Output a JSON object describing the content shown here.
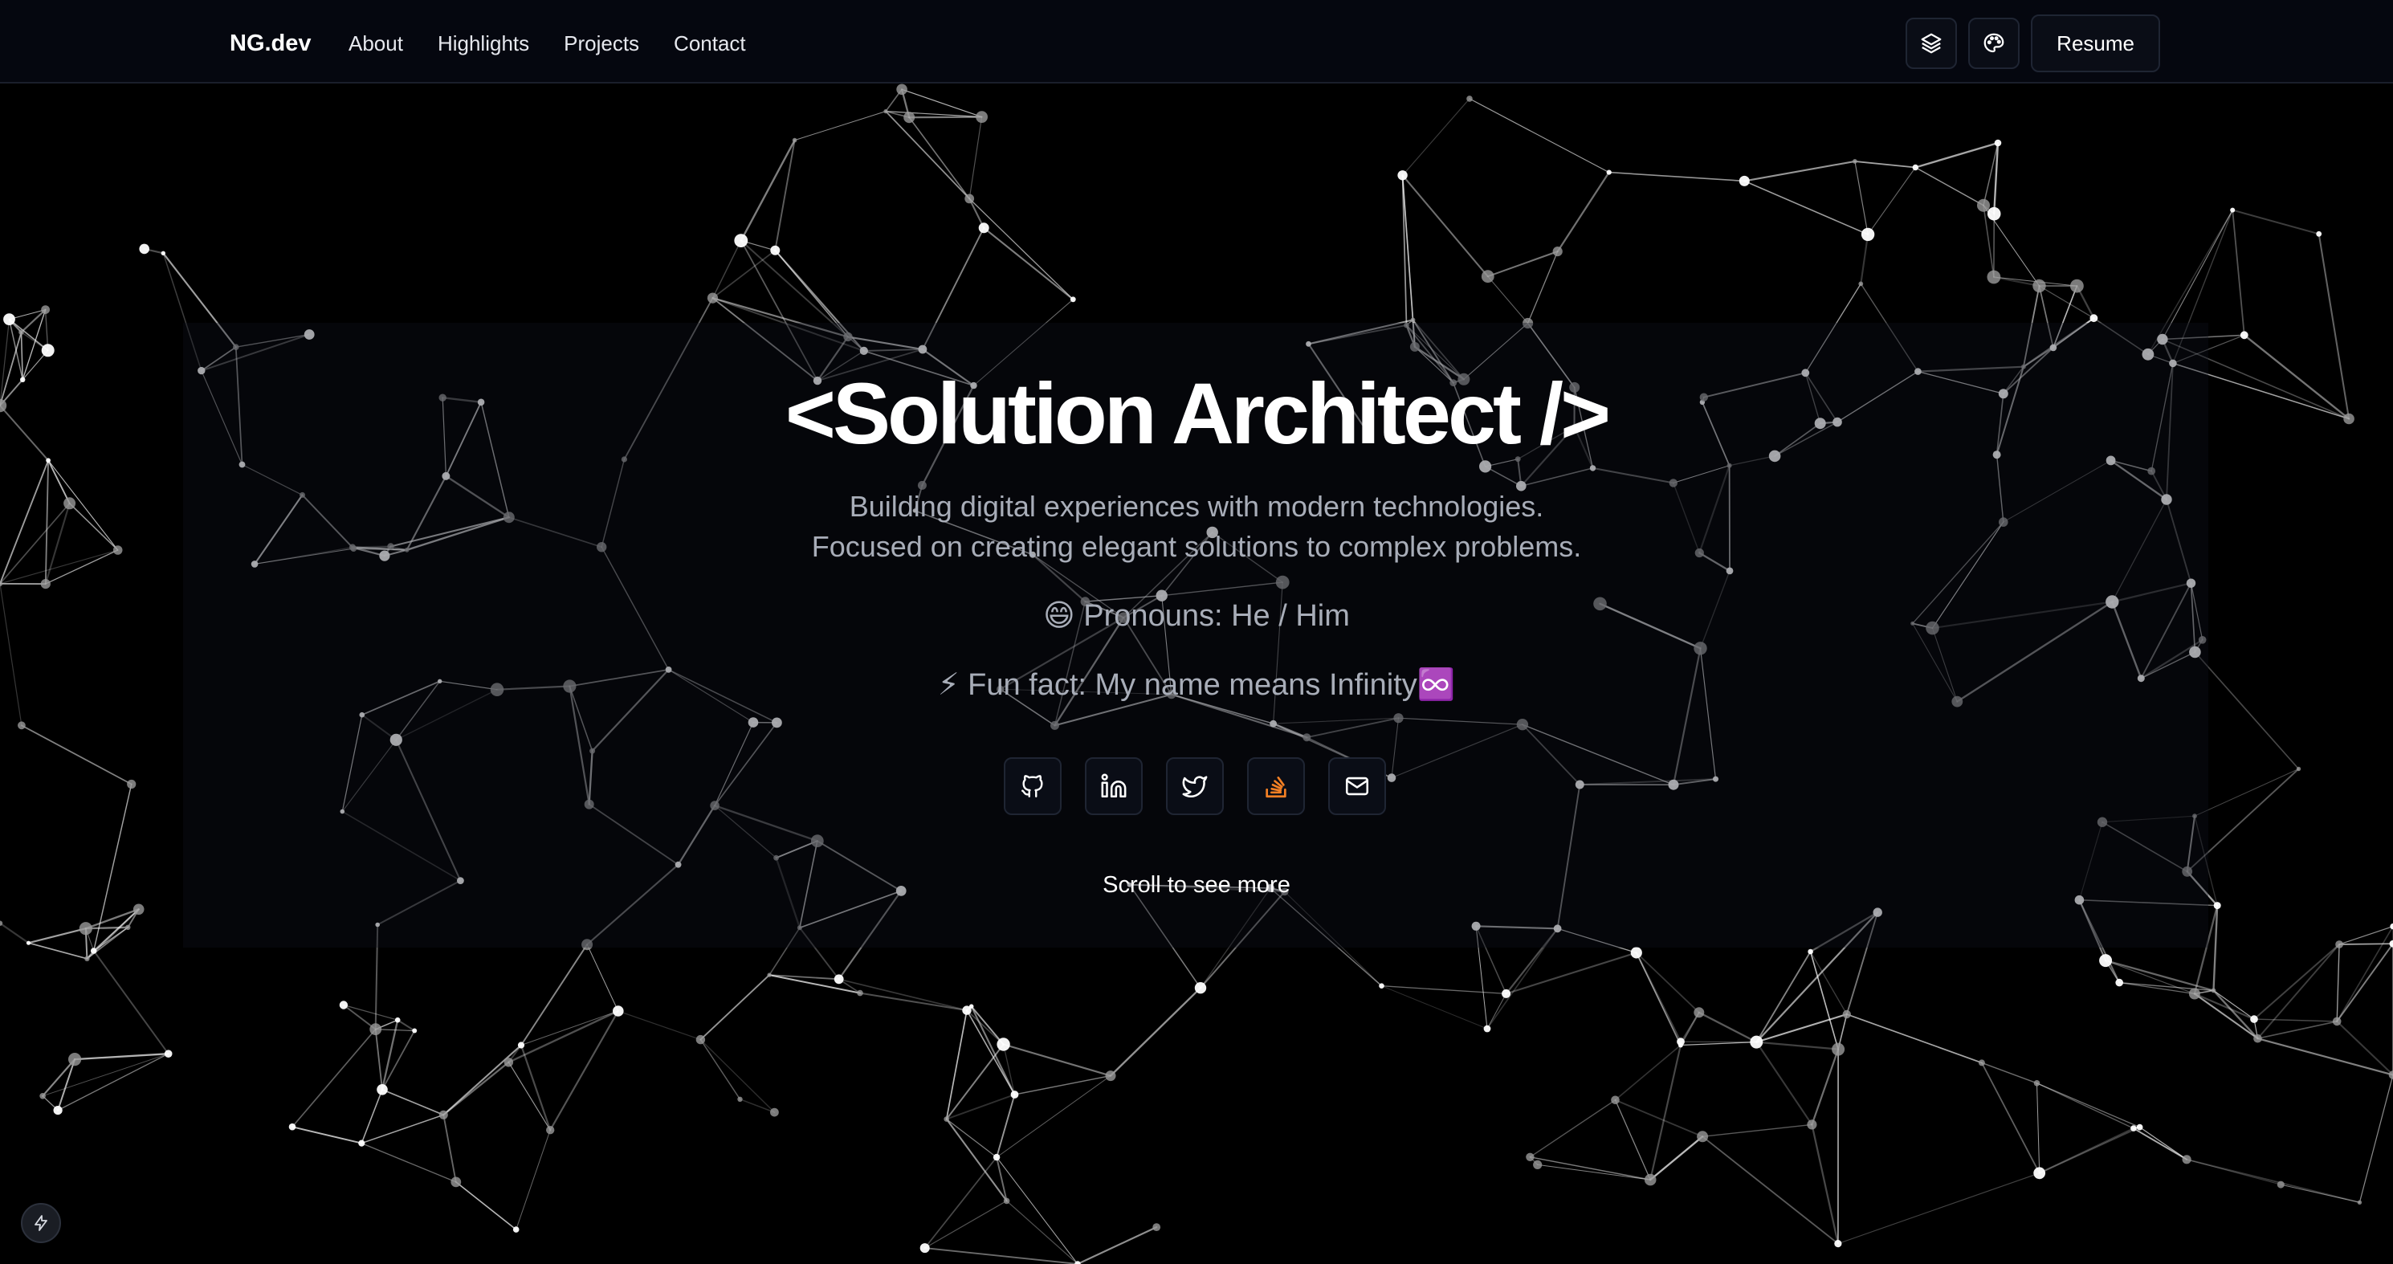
{
  "nav": {
    "brand": "NG.dev",
    "links": [
      "About",
      "Highlights",
      "Projects",
      "Contact"
    ],
    "layers_icon": "layers-icon",
    "palette_icon": "palette-icon",
    "resume_label": "Resume"
  },
  "hero": {
    "title": "<Solution Architect  />",
    "subtitle_line1": "Building digital experiences with modern technologies.",
    "subtitle_line2": "Focused on creating elegant solutions to complex problems.",
    "pronouns": "😄 Pronouns: He / Him",
    "fun_fact": "⚡ Fun fact: My name means Infinity♾️",
    "scroll_hint": "Scroll to see more"
  },
  "socials": [
    {
      "icon": "github-icon"
    },
    {
      "icon": "linkedin-icon"
    },
    {
      "icon": "twitter-icon"
    },
    {
      "icon": "stackoverflow-icon",
      "color": "#f48024"
    },
    {
      "icon": "mail-icon"
    }
  ],
  "corner_button": {
    "icon": "bolt-icon"
  },
  "colors": {
    "background": "#000000",
    "nav_background": "#050810",
    "muted_text": "#a8adb8",
    "accent_stackoverflow": "#f48024"
  }
}
